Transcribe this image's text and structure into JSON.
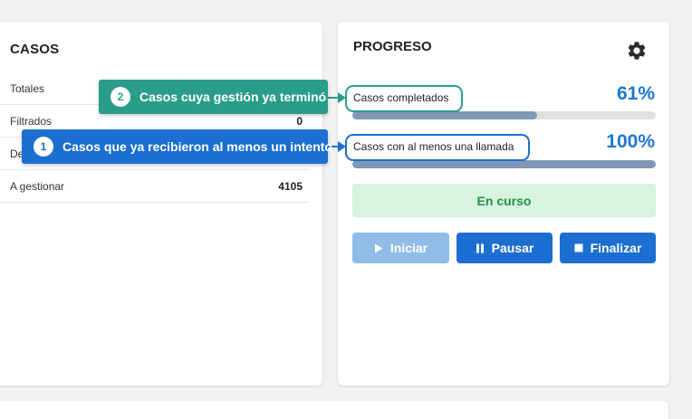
{
  "casos": {
    "title": "CASOS",
    "rows": [
      {
        "label": "Totales",
        "value": ""
      },
      {
        "label": "Filtrados",
        "value": "0"
      },
      {
        "label": "De",
        "value": ""
      },
      {
        "label": "A gestionar",
        "value": "4105"
      }
    ]
  },
  "progreso": {
    "title": "PROGRESO",
    "settings_icon": "gear-icon",
    "metrics": [
      {
        "label": "Casos completados",
        "percent_text": "61%",
        "percent": 61
      },
      {
        "label": "Casos con al menos una llamada",
        "percent_text": "100%",
        "percent": 100
      }
    ],
    "status": "En curso",
    "buttons": {
      "iniciar": {
        "label": "Iniciar",
        "icon": "play-icon",
        "disabled": true
      },
      "pausar": {
        "label": "Pausar",
        "icon": "pause-icon"
      },
      "finalizar": {
        "label": "Finalizar",
        "icon": "stop-icon"
      }
    }
  },
  "callouts": [
    {
      "number": "2",
      "text": "Casos cuya gestión ya terminó",
      "color": "#2a9d8a"
    },
    {
      "number": "1",
      "text": "Casos que ya recibieron al menos un intento",
      "color": "#1c6fd0"
    }
  ],
  "colors": {
    "primary": "#1c6fd0",
    "primary_disabled": "#8fbde8",
    "accent_teal": "#2a9d8a",
    "status_bg": "#d8f3df",
    "status_text": "#23904a",
    "bar_fill": "#7f98b5",
    "percent_text": "#1f77d0"
  }
}
